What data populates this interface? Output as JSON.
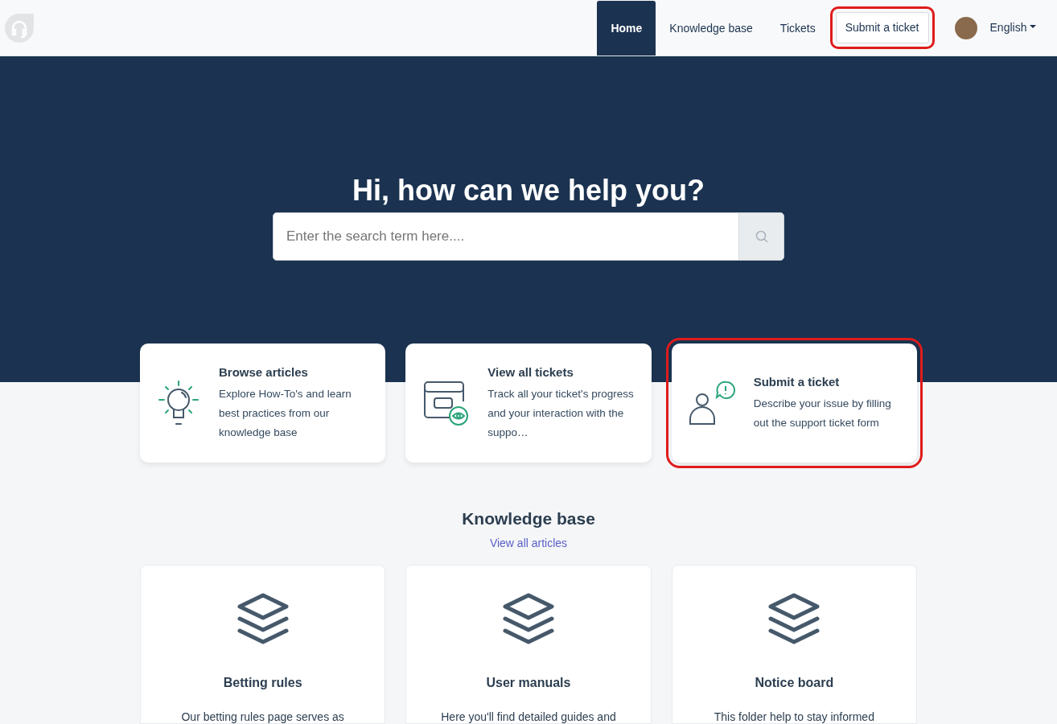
{
  "nav": {
    "items": [
      {
        "label": "Home",
        "selected": true,
        "kind": "link",
        "highlighted": false
      },
      {
        "label": "Knowledge base",
        "selected": false,
        "kind": "link",
        "highlighted": false
      },
      {
        "label": "Tickets",
        "selected": false,
        "kind": "link",
        "highlighted": false
      },
      {
        "label": "Submit a ticket",
        "selected": false,
        "kind": "button",
        "highlighted": true
      }
    ],
    "language": "English"
  },
  "hero": {
    "title": "Hi, how can we help you?",
    "search": {
      "placeholder": "Enter the search term here...."
    }
  },
  "actions": [
    {
      "kind": "bulb",
      "title": "Browse articles",
      "text": "Explore How-To's and learn best practices from our knowledge base",
      "highlighted": false
    },
    {
      "kind": "tickets",
      "title": "View all tickets",
      "text": "Track all your ticket's progress and your interaction with the suppo…",
      "highlighted": false
    },
    {
      "kind": "person",
      "title": "Submit a ticket",
      "text": "Describe your issue by filling out the support ticket form",
      "highlighted": true
    }
  ],
  "knowledge_base": {
    "title": "Knowledge base",
    "link": "View all articles",
    "folders": [
      {
        "title": "Betting rules",
        "text": "Our betting rules page serves as"
      },
      {
        "title": "User manuals",
        "text": "Here you'll find detailed guides and"
      },
      {
        "title": "Notice board",
        "text": "This folder help to stay informed"
      }
    ]
  }
}
